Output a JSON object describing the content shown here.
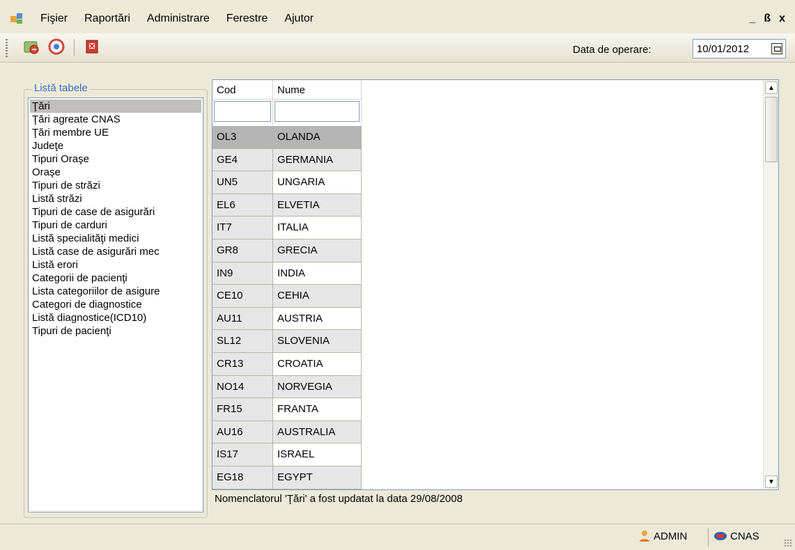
{
  "menu": {
    "items": [
      "Fişier",
      "Raportări",
      "Administrare",
      "Ferestre",
      "Ajutor"
    ]
  },
  "window_controls": {
    "minimize": "_",
    "restore": "ß",
    "close": "x"
  },
  "toolbar": {
    "icons": [
      "refresh-icon",
      "sync-icon",
      "exit-icon"
    ],
    "date_label": "Data de operare:",
    "date_value": "10/01/2012"
  },
  "sidebar": {
    "title": "Listă tabele",
    "items": [
      "Ţări",
      "Ţări agreate CNAS",
      "Ţări membre UE",
      "Judeţe",
      "Tipuri Oraşe",
      "Oraşe",
      "Tipuri de străzi",
      "Listă străzi",
      "Tipuri de case de asigurări",
      "Tipuri de carduri",
      "Listă specialităţi medici",
      "Listă case de asigurări mec",
      "Listă erori",
      "Categorii de pacienţi",
      "Lista categoriilor de asigure",
      "Categori de diagnostice",
      "Listă diagnostice(ICD10)",
      "Tipuri de pacienţi"
    ],
    "selected_index": 0
  },
  "grid": {
    "columns": [
      "Cod",
      "Nume"
    ],
    "filter_placeholders": [
      "",
      ""
    ],
    "rows": [
      [
        "OL3",
        "OLANDA"
      ],
      [
        "GE4",
        "GERMANIA"
      ],
      [
        "UN5",
        "UNGARIA"
      ],
      [
        "EL6",
        "ELVETIA"
      ],
      [
        "IT7",
        "ITALIA"
      ],
      [
        "GR8",
        "GRECIA"
      ],
      [
        "IN9",
        "INDIA"
      ],
      [
        "CE10",
        "CEHIA"
      ],
      [
        "AU11",
        "AUSTRIA"
      ],
      [
        "SL12",
        "SLOVENIA"
      ],
      [
        "CR13",
        "CROATIA"
      ],
      [
        "NO14",
        "NORVEGIA"
      ],
      [
        "FR15",
        "FRANTA"
      ],
      [
        "AU16",
        "AUSTRALIA"
      ],
      [
        "IS17",
        "ISRAEL"
      ],
      [
        "EG18",
        "EGYPT"
      ]
    ],
    "selected_row": 0
  },
  "status_message": "Nomenclatorul 'Ţări' a fost updatat la data 29/08/2008",
  "statusbar": {
    "user": "ADMIN",
    "institution": "CNAS"
  }
}
